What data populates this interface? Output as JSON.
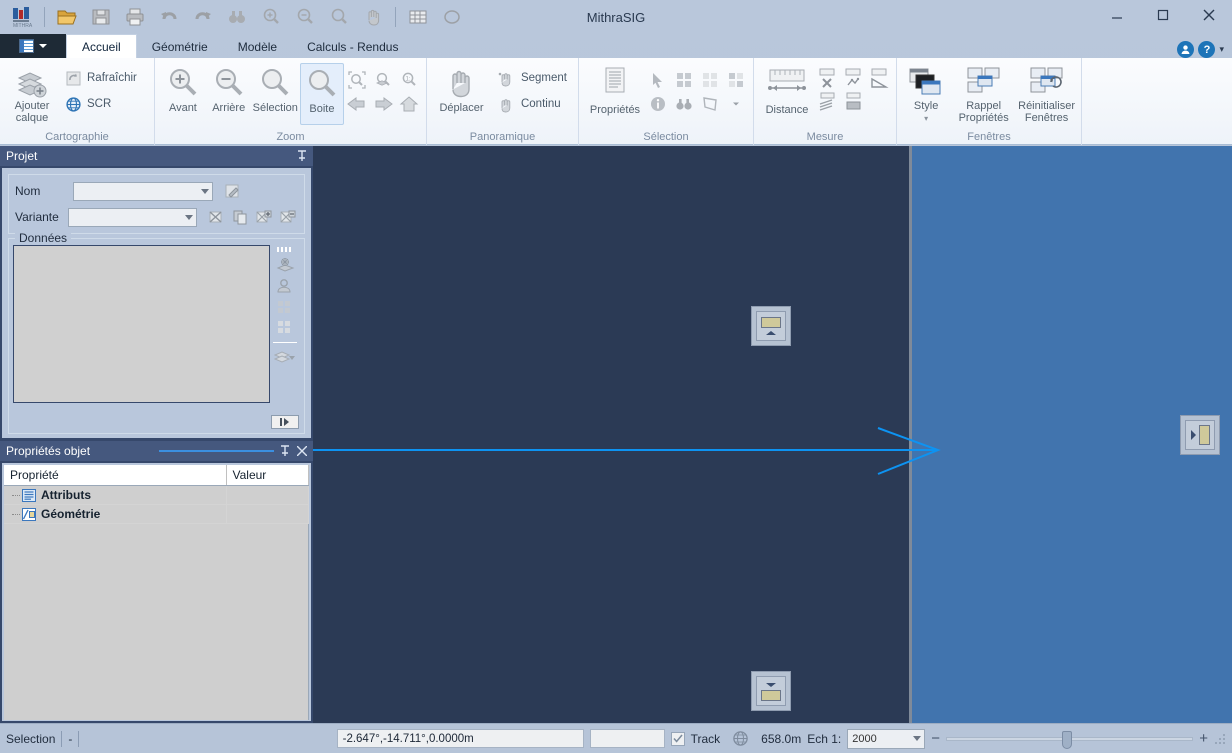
{
  "window": {
    "title": "MithraSIG",
    "minimize": "—",
    "maximize": "□",
    "close": "✕"
  },
  "quick_access": {
    "logo_label": "MITHRA",
    "items": [
      {
        "name": "open-icon",
        "glyph": "open"
      },
      {
        "name": "save-icon",
        "glyph": "save"
      },
      {
        "name": "print-icon",
        "glyph": "print"
      },
      {
        "name": "undo-icon",
        "glyph": "undo"
      },
      {
        "name": "redo-icon",
        "glyph": "redo"
      },
      {
        "name": "binoculars-icon",
        "glyph": "binoculars"
      },
      {
        "name": "zoom-in-icon",
        "glyph": "zoomin"
      },
      {
        "name": "zoom-out-icon",
        "glyph": "zoomout"
      },
      {
        "name": "zoom-icon",
        "glyph": "zoom"
      },
      {
        "name": "pan-hand-icon",
        "glyph": "hand"
      },
      {
        "name": "table-icon",
        "glyph": "table"
      },
      {
        "name": "ellipse-icon",
        "glyph": "ellipse"
      }
    ]
  },
  "tabs": [
    {
      "label": "Accueil",
      "active": true
    },
    {
      "label": "Géométrie",
      "active": false
    },
    {
      "label": "Modèle",
      "active": false
    },
    {
      "label": "Calculs - Rendus",
      "active": false
    }
  ],
  "tab_right": {
    "account_icon": "account-icon",
    "help_icon": "help-icon",
    "help_glyph": "?",
    "account_glyph": "●",
    "chevron": "▾"
  },
  "ribbon": {
    "groups": [
      {
        "title": "Cartographie",
        "big": [
          {
            "label1": "Ajouter",
            "label2": "calque",
            "name": "add-layer-button"
          }
        ],
        "small": [
          {
            "label": "Rafraîchir",
            "name": "refresh-button"
          },
          {
            "label": "SCR",
            "name": "scr-button"
          }
        ]
      },
      {
        "title": "Zoom",
        "big": [
          {
            "label1": "Avant",
            "label2": "",
            "name": "zoom-in-button"
          },
          {
            "label1": "Arrière",
            "label2": "",
            "name": "zoom-out-button"
          },
          {
            "label1": "Sélection",
            "label2": "",
            "name": "zoom-selection-button"
          },
          {
            "label1": "Boite",
            "label2": "",
            "name": "zoom-box-button"
          }
        ],
        "icons": [
          "zoom-extents-icon",
          "zoom-layer-icon",
          "zoom-scale-icon",
          "back-arrow-icon",
          "forward-arrow-icon",
          "home-icon"
        ]
      },
      {
        "title": "Panoramique",
        "big": [
          {
            "label1": "Déplacer",
            "label2": "",
            "name": "pan-move-button"
          }
        ],
        "small": [
          {
            "label": "Segment",
            "name": "pan-segment-button"
          },
          {
            "label": "Continu",
            "name": "pan-continuous-button"
          }
        ]
      },
      {
        "title": "Sélection",
        "big": [
          {
            "label1": "Propriétés",
            "label2": "",
            "name": "properties-button"
          }
        ],
        "icons": [
          "arrow-cursor-icon",
          "select-all-icon",
          "deselect-icon",
          "invert-selection-icon",
          "info-icon",
          "binoculars-icon",
          "polygon-select-icon",
          "more-chevron-icon"
        ]
      },
      {
        "title": "Mesure",
        "big": [
          {
            "label1": "Distance",
            "label2": "",
            "name": "measure-distance-button"
          }
        ],
        "icons": [
          "measure-cross-icon",
          "measure-multi-icon",
          "measure-angle-icon",
          "measure-profile-icon",
          "measure-area-icon"
        ]
      },
      {
        "title": "Fenêtres",
        "big": [
          {
            "label1": "Style",
            "label2": "▾",
            "name": "style-button"
          },
          {
            "label1": "Rappel",
            "label2": "Propriétés",
            "name": "recall-properties-button"
          },
          {
            "label1": "Réinitialiser",
            "label2": "Fenêtres",
            "name": "reset-windows-button"
          }
        ]
      }
    ]
  },
  "project_panel": {
    "title": "Projet",
    "pin": "⇅",
    "fields": [
      {
        "label": "Nom",
        "value": "",
        "placeholder": "",
        "name": "project-name-combo"
      },
      {
        "label": "Variante",
        "value": "",
        "placeholder": "",
        "name": "project-variant-combo"
      }
    ],
    "name_buttons": [
      "edit-project-icon"
    ],
    "variant_buttons": [
      "delete-variant-icon",
      "copy-variant-icon",
      "add-variant-icon",
      "remove-variant-icon"
    ],
    "data_legend": "Données",
    "data_tools": [
      "layer-settings-icon",
      "layer-person-icon",
      "grid-all-icon",
      "grid-some-icon",
      "stack-layers-icon"
    ],
    "scroll_nub": "▮▸"
  },
  "properties_panel": {
    "title": "Propriétés objet",
    "pin": "⇅",
    "close": "✕",
    "columns": [
      "Propriété",
      "Valeur"
    ],
    "rows": [
      {
        "property": "Attributs",
        "value": "",
        "icon": "attributes-icon"
      },
      {
        "property": "Géométrie",
        "value": "",
        "icon": "geometry-icon"
      }
    ]
  },
  "canvas": {
    "left_pane_color": "#2b3a55",
    "right_pane_color": "#4174ae",
    "divider_color": "#7f8a99",
    "marker_color": "#0d93f2",
    "widgets": [
      {
        "name": "map-widget-top",
        "glyph": "bar-over-triangle"
      },
      {
        "name": "map-widget-bottom",
        "glyph": "triangle-over-bar"
      },
      {
        "name": "map-widget-right",
        "glyph": "arrow-beside-bar"
      }
    ]
  },
  "statusbar": {
    "mode_label": "Selection",
    "mode_value": "-",
    "coordinates": "-2.647°,-14.711°,0.0000m",
    "secondary_field": "",
    "track_label": "Track",
    "track_checked": true,
    "globe_icon": "globe-icon",
    "distance": "658.0m",
    "scale_label": "Ech 1:",
    "scale_value": "2000",
    "zoom_out": "−",
    "zoom_in": "+",
    "zoom_percent": 47
  },
  "colors": {
    "titlebar": "#b8c6da",
    "ribbon": "#f3f7fc",
    "dock": "#36486b",
    "panel_header": "#45587e",
    "panel_body": "#b9c7dc",
    "accent": "#1d74b8"
  }
}
